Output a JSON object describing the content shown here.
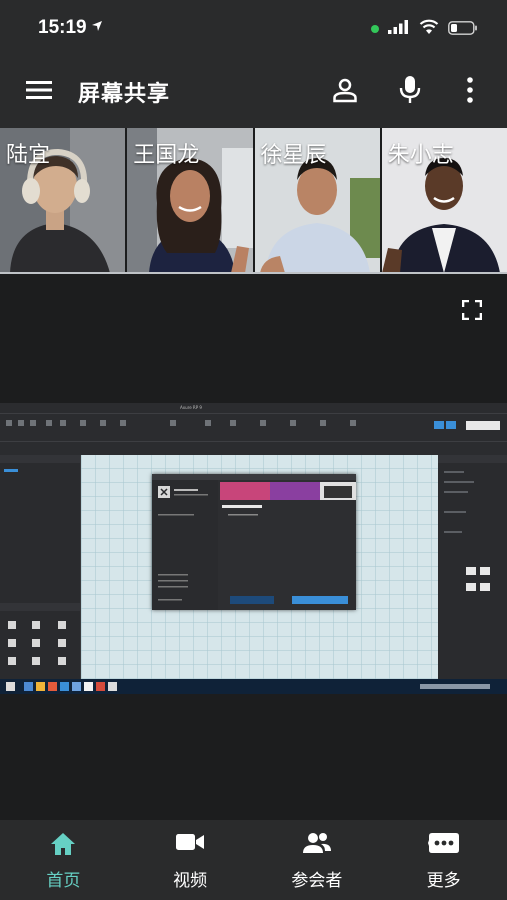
{
  "status_bar": {
    "time": "15:19"
  },
  "app_bar": {
    "title": "屏幕共享"
  },
  "participants": [
    {
      "name": "陆宜"
    },
    {
      "name": "王国龙"
    },
    {
      "name": "徐星辰"
    },
    {
      "name": "朱小志"
    }
  ],
  "shared_screen": {
    "app_title": "Axure RP 9",
    "dialog_title": "最近的项目",
    "primary_button": "打开文件",
    "secondary_button": "新建项目"
  },
  "bottom_nav": {
    "items": [
      {
        "label": "首页",
        "icon": "home-icon",
        "active": true
      },
      {
        "label": "视频",
        "icon": "video-camera-icon",
        "active": false
      },
      {
        "label": "参会者",
        "icon": "people-icon",
        "active": false
      },
      {
        "label": "更多",
        "icon": "more-chat-icon",
        "active": false
      }
    ]
  },
  "colors": {
    "accent": "#66d0c4",
    "bar_bg": "#2a2b2c",
    "page_bg": "#1c1d1e"
  }
}
